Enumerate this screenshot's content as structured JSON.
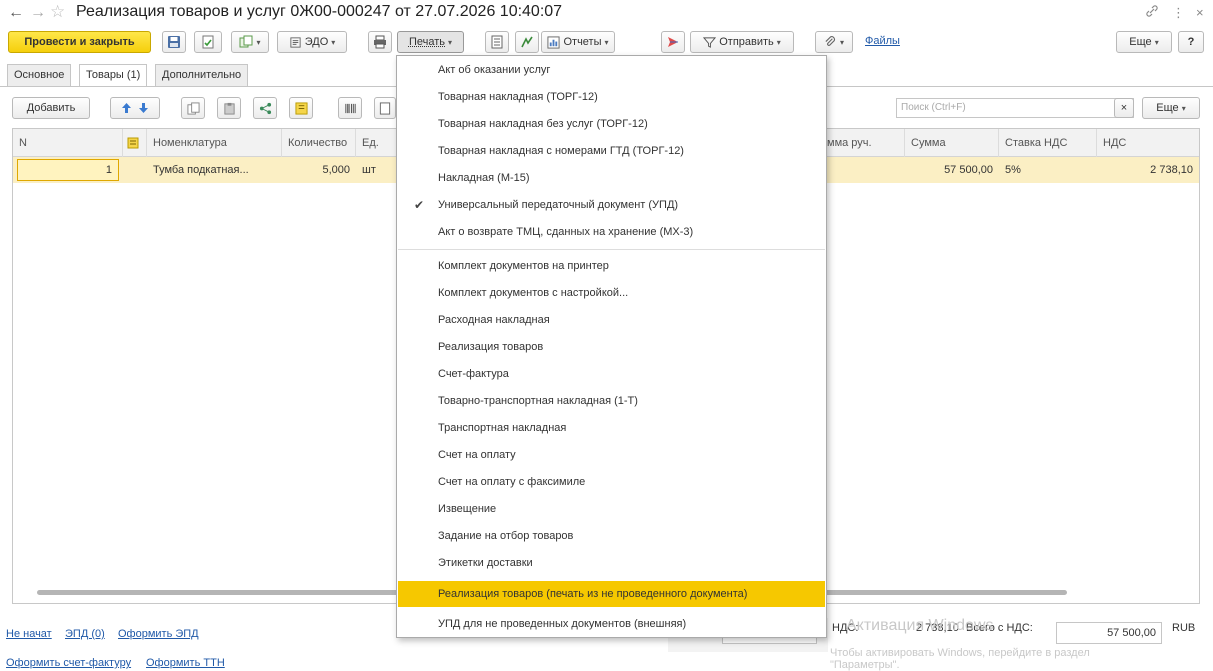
{
  "window": {
    "title": "Реализация товаров и услуг 0Ж00-000247 от 27.07.2026 10:40:07",
    "back_symbol": "←",
    "forward_symbol": "→",
    "star_symbol": "☆",
    "link_symbol": "🔗",
    "more_symbol": "⋮",
    "close_symbol": "×"
  },
  "toolbar": {
    "post_close": "Провести и закрыть",
    "edo": "ЭДО",
    "print": "Печать",
    "reports": "Отчеты",
    "send": "Отправить",
    "files": "Файлы",
    "more": "Еще",
    "help": "?"
  },
  "tabs": [
    "Основное",
    "Товары (1)",
    "Дополнительно"
  ],
  "table_toolbar": {
    "add": "Добавить",
    "search_placeholder": "Поиск (Ctrl+F)",
    "clear": "×",
    "more": "Еще"
  },
  "table": {
    "headers": {
      "n": "N",
      "nomenclature": "Номенклатура",
      "qty": "Количество",
      "unit": "Ед.",
      "sum_manual": "мма руч.",
      "sum": "Сумма",
      "vat_rate": "Ставка НДС",
      "vat": "НДС"
    },
    "rows": [
      {
        "n": "1",
        "nomenclature": "Тумба подкатная...",
        "qty": "5,000",
        "unit": "шт",
        "sum": "57 500,00",
        "vat_rate": "5%",
        "vat": "2 738,10"
      }
    ]
  },
  "print_menu": {
    "items": [
      "Акт об оказании услуг",
      "Товарная накладная (ТОРГ-12)",
      "Товарная накладная без услуг (ТОРГ-12)",
      "Товарная накладная с номерами ГТД (ТОРГ-12)",
      "Накладная (М-15)",
      "Универсальный передаточный документ (УПД)",
      "Акт о возврате ТМЦ, сданных на хранение (МХ-3)",
      "Комплект документов на принтер",
      "Комплект документов с настройкой...",
      "Расходная накладная",
      "Реализация товаров",
      "Счет-фактура",
      "Товарно-транспортная накладная (1-Т)",
      "Транспортная накладная",
      "Счет на оплату",
      "Счет на оплату с факсимиле",
      "Извещение",
      "Задание на отбор товаров",
      "Этикетки доставки",
      "Реализация товаров (печать из не проведенного документа)",
      "УПД для не проведенных документов (внешняя)"
    ],
    "checked_symbol": "✔"
  },
  "footer": {
    "link_not_started": "Не начат",
    "link_epd": "ЭПД (0)",
    "link_make_epd": "Оформить ЭПД",
    "link_invoice": "Оформить счет-фактуру",
    "link_ttn": "Оформить ТТН",
    "vat_label": "НДС:",
    "vat_value": "2 738,10",
    "total_label": "Всего с НДС:",
    "total_value": "57 500,00",
    "currency": "RUB"
  },
  "watermark": {
    "line1": "Активация Windows",
    "line2": "Чтобы активировать Windows, перейдите в раздел",
    "line3": "\"Параметры\"."
  },
  "colors": {
    "accent": "#f6c800",
    "link": "#2059a8",
    "row_selected": "#fbefc4"
  }
}
